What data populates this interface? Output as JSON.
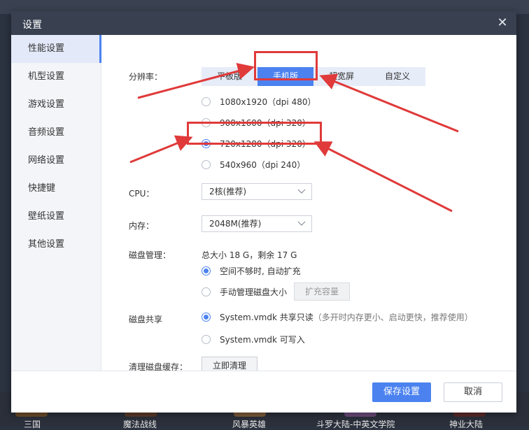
{
  "dialog": {
    "title": "设置",
    "close_icon": "close-icon"
  },
  "sidebar": {
    "items": [
      {
        "label": "性能设置",
        "active": true
      },
      {
        "label": "机型设置"
      },
      {
        "label": "游戏设置"
      },
      {
        "label": "音频设置"
      },
      {
        "label": "网络设置"
      },
      {
        "label": "快捷键"
      },
      {
        "label": "壁纸设置"
      },
      {
        "label": "其他设置"
      }
    ]
  },
  "resolution": {
    "label": "分辨率：",
    "tabs": [
      "平板版",
      "手机版",
      "超宽屏",
      "自定义"
    ],
    "active_tab": "手机版",
    "options": [
      {
        "label": "1080x1920（dpi 480）",
        "checked": false
      },
      {
        "label": "900x1600（dpi 320）",
        "checked": false
      },
      {
        "label": "720x1280（dpi 320）",
        "checked": true
      },
      {
        "label": "540x960（dpi 240）",
        "checked": false
      }
    ]
  },
  "cpu": {
    "label": "CPU：",
    "value": "2核(推荐)"
  },
  "memory": {
    "label": "内存：",
    "value": "2048M(推荐)"
  },
  "disk_management": {
    "label": "磁盘管理：",
    "summary": "总大小 18 G，剩余 17 G",
    "options": [
      {
        "label": "空间不够时, 自动扩充",
        "checked": true
      },
      {
        "label": "手动管理磁盘大小",
        "checked": false
      }
    ],
    "expand_button": "扩充容量"
  },
  "disk_sharing": {
    "label": "磁盘共享",
    "options": [
      {
        "label": "System.vmdk 共享只读",
        "hint": "（多开时内存更小、启动更快，推荐使用）",
        "checked": true
      },
      {
        "label": "System.vmdk 可写入",
        "hint": "",
        "checked": false
      }
    ]
  },
  "clear_cache": {
    "label": "清理磁盘缓存：",
    "button": "立即清理"
  },
  "footer": {
    "save": "保存设置",
    "cancel": "取消"
  },
  "background_labels": [
    "三国",
    "魔法战线",
    "风暴英雄",
    "斗罗大陆-中英文学院",
    "神业大陆"
  ],
  "colors": {
    "accent": "#4b82f0",
    "titlebar": "#394150",
    "annotation": "#e03a3a"
  }
}
